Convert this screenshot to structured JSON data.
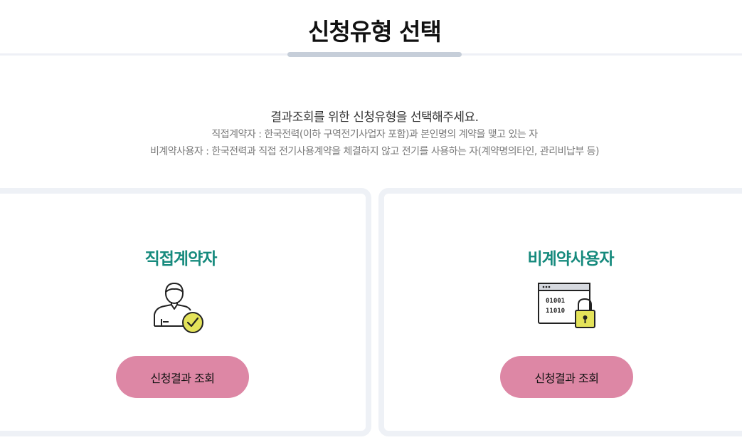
{
  "header": {
    "title": "신청유형 선택"
  },
  "intro": {
    "main": "결과조회를 위한 신청유형을 선택해주세요.",
    "direct_desc": "직접계약자 : 한국전력(이하 구역전기사업자 포함)과 본인명의 계약을 맺고 있는 자",
    "nondirect_desc": "비계약사용자 : 한국전력과 직접 전기사용계약을 체결하지 않고 전기를 사용하는 자(계약명의타인, 관리비납부 등)"
  },
  "cards": [
    {
      "title": "직접계약자",
      "icon": "user-check-icon",
      "button_label": "신청결과 조회"
    },
    {
      "title": "비계약사용자",
      "icon": "secure-data-lock-icon",
      "button_label": "신청결과 조회",
      "icon_text": [
        "01001",
        "11010"
      ]
    }
  ],
  "colors": {
    "accent_title": "#168a7d",
    "button": "#dd87a5",
    "card_border": "#eef1f6",
    "icon_yellow": "#e4e35a"
  }
}
